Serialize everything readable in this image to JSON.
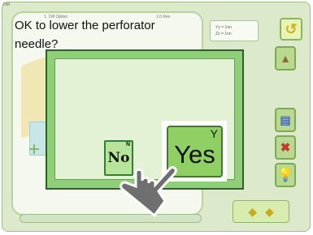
{
  "screen": {
    "corner_label": "DM",
    "work_header_left": "1. 1W Option",
    "work_header_right": "1.0 Rev",
    "coord_line1": "Yy = 1nn",
    "coord_line2": "Zz = 1nn"
  },
  "dialog": {
    "message": "OK to lower the perforator\nneedle?",
    "no_label": "No",
    "no_hint": "N",
    "yes_label": "Yes",
    "yes_hint": "Y"
  },
  "side_icons": [
    "undo-icon",
    "mirror-icon",
    "stamp-icon",
    "delete-icon",
    "light-icon"
  ],
  "colors": {
    "dialog_fill": "#8fcf77",
    "dialog_inner": "#e3f1d5",
    "button_green": "#8fcf63",
    "frame_bg": "#dceacb"
  }
}
